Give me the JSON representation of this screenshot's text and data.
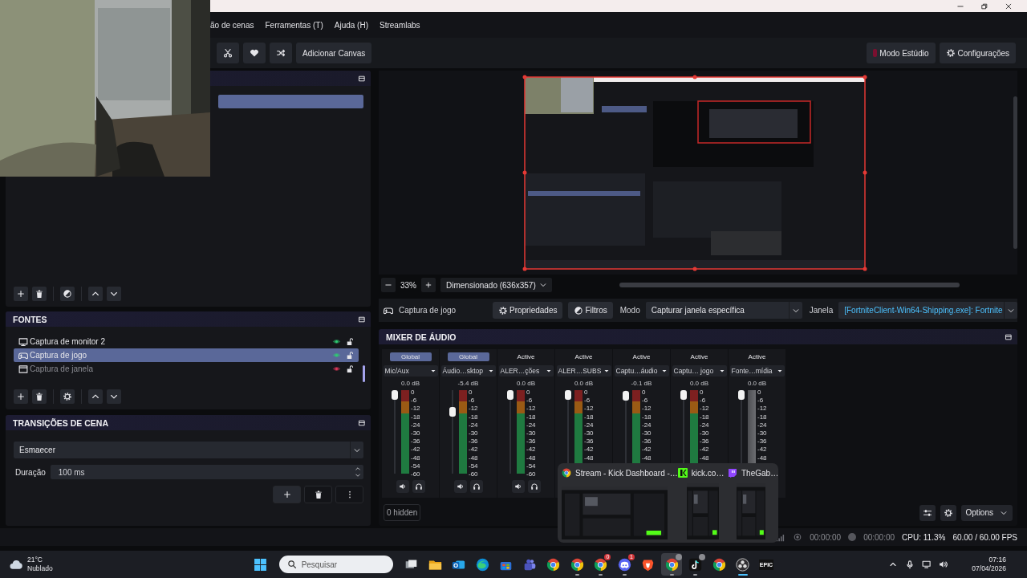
{
  "menu": [
    "ão de cenas",
    "Ferramentas (T)",
    "Ajuda (H)",
    "Streamlabs"
  ],
  "toolbar": {
    "tools": [
      {
        "kind": "scissors"
      },
      {
        "kind": "heart"
      },
      {
        "kind": "shuffle"
      }
    ],
    "add_canvas": "Adicionar Canvas",
    "studio_mode": "Modo Estúdio",
    "settings": "Configurações"
  },
  "scenes": {
    "rows": [
      {
        "selected": true
      }
    ]
  },
  "sources": {
    "title": "FONTES",
    "items": [
      {
        "kind": "monitor",
        "name": "Captura de monitor 2",
        "visible": true,
        "locked": false,
        "selected": false
      },
      {
        "kind": "game",
        "name": "Captura de jogo",
        "visible": true,
        "locked": false,
        "selected": true
      },
      {
        "kind": "window",
        "name": "Captura de janela",
        "visible": false,
        "locked": false,
        "selected": false
      }
    ]
  },
  "transitions": {
    "title": "TRANSIÇÕES DE CENA",
    "type": "Esmaecer",
    "duration_label": "Duração",
    "duration": "100 ms"
  },
  "preview": {
    "zoom": "33%",
    "scale_mode": "Dimensionado (636x357)"
  },
  "source_bar": {
    "name": "Captura de jogo",
    "properties": "Propriedades",
    "filters": "Filtros",
    "mode_label": "Modo",
    "mode": "Capturar janela específica",
    "window_label": "Janela",
    "window": "[FortniteClient-Win64-Shipping.exe]: Fortnite"
  },
  "mixer": {
    "title": "MIXER DE ÁUDIO",
    "hidden": "0 hidden",
    "options": "Options",
    "channels": [
      {
        "badge": "Global",
        "global": true,
        "name": "Mic/Aux",
        "db": "0.0 dB",
        "level": 1,
        "meter_active": true,
        "controls": true,
        "scale": [
          "0",
          "-6",
          "-12",
          "-18",
          "-24",
          "-30",
          "-36",
          "-42",
          "-48",
          "-54",
          "-60"
        ]
      },
      {
        "badge": "Global",
        "global": true,
        "name": "Áudio…sktop",
        "db": "-5.4 dB",
        "level": 0.78,
        "meter_active": true,
        "controls": true,
        "scale": [
          "0",
          "-6",
          "-12",
          "-18",
          "-24",
          "-30",
          "-36",
          "-42",
          "-48",
          "-54",
          "-60"
        ]
      },
      {
        "badge": "Active",
        "global": false,
        "name": "ALER…ções",
        "db": "0.0 dB",
        "level": 1,
        "meter_active": true,
        "controls": true,
        "scale": [
          "0",
          "-6",
          "-12",
          "-18",
          "-24",
          "-30",
          "-36",
          "-42",
          "-48",
          "-54",
          "-60"
        ]
      },
      {
        "badge": "Active",
        "global": false,
        "name": "ALER…SUBS",
        "db": "0.0 dB",
        "level": 1,
        "meter_active": true,
        "scale": [
          "0",
          "-6",
          "-12",
          "-18",
          "-24",
          "-30",
          "-36",
          "-42",
          "-48"
        ]
      },
      {
        "badge": "Active",
        "global": false,
        "name": "Captu…áudio",
        "db": "-0.1 dB",
        "level": 0.99,
        "meter_active": true,
        "scale": [
          "0",
          "-6",
          "-12",
          "-18",
          "-24",
          "-30",
          "-36",
          "-42",
          "-48"
        ]
      },
      {
        "badge": "Active",
        "global": false,
        "name": "Captu… jogo",
        "db": "0.0 dB",
        "level": 1,
        "meter_active": true,
        "scale": [
          "0",
          "-6",
          "-12",
          "-18",
          "-24",
          "-30",
          "-36",
          "-42",
          "-48"
        ]
      },
      {
        "badge": "Active",
        "global": false,
        "name": "Fonte…mídia",
        "db": "0.0 dB",
        "level": 1,
        "meter_active": false,
        "scale": [
          "0",
          "-6",
          "-12",
          "-18",
          "-24",
          "-30",
          "-36",
          "-42",
          "-48"
        ]
      }
    ]
  },
  "status_bar": {
    "stream_time": "00:00:00",
    "record_time": "00:00:00",
    "cpu": "CPU: 11.3%",
    "fps": "60.00 / 60.00 FPS"
  },
  "taskbar_popup": {
    "windows": [
      {
        "kind": "chrome",
        "title": "Stream - Kick Dashboard -…"
      },
      {
        "kind": "kick",
        "title": "kick.co…"
      },
      {
        "kind": "twitch",
        "title": "TheGab…"
      }
    ]
  },
  "taskbar": {
    "weather": {
      "temp": "21°C",
      "condition": "Nublado"
    },
    "search": "Pesquisar",
    "apps": [
      {
        "kind": "taskview",
        "running": false,
        "focused": false,
        "highlighted": false
      },
      {
        "kind": "folder",
        "running": false,
        "focused": false,
        "highlighted": false
      },
      {
        "kind": "mail",
        "running": false,
        "focused": false,
        "highlighted": false
      },
      {
        "kind": "edge",
        "running": false,
        "focused": false,
        "highlighted": false
      },
      {
        "kind": "store",
        "running": false,
        "focused": false,
        "highlighted": false
      },
      {
        "kind": "teams",
        "running": false,
        "focused": false,
        "highlighted": false
      },
      {
        "kind": "chrome",
        "running": false,
        "focused": false,
        "highlighted": false
      },
      {
        "kind": "chrome",
        "running": true,
        "focused": false,
        "highlighted": false
      },
      {
        "kind": "chrome",
        "running": true,
        "focused": false,
        "highlighted": false,
        "badge": true,
        "badge_alert": true,
        "badge_text": "0"
      },
      {
        "kind": "discord",
        "running": true,
        "focused": false,
        "highlighted": false,
        "badge": true,
        "badge_alert": true,
        "badge_text": "1"
      },
      {
        "kind": "brave",
        "running": false,
        "focused": false,
        "highlighted": false
      },
      {
        "kind": "chrome",
        "running": true,
        "focused": false,
        "highlighted": true,
        "badge": true,
        "badge_alert": false
      },
      {
        "kind": "tiktok",
        "running": true,
        "focused": false,
        "highlighted": false,
        "badge": true,
        "badge_alert": false
      },
      {
        "kind": "chrome",
        "running": false,
        "focused": false,
        "highlighted": false
      },
      {
        "kind": "obs",
        "running": true,
        "focused": true,
        "highlighted": false
      },
      {
        "kind": "epic",
        "running": false,
        "focused": false,
        "highlighted": false,
        "label": "EPIC"
      }
    ],
    "time": "07:16",
    "date": "07/04/2026"
  }
}
